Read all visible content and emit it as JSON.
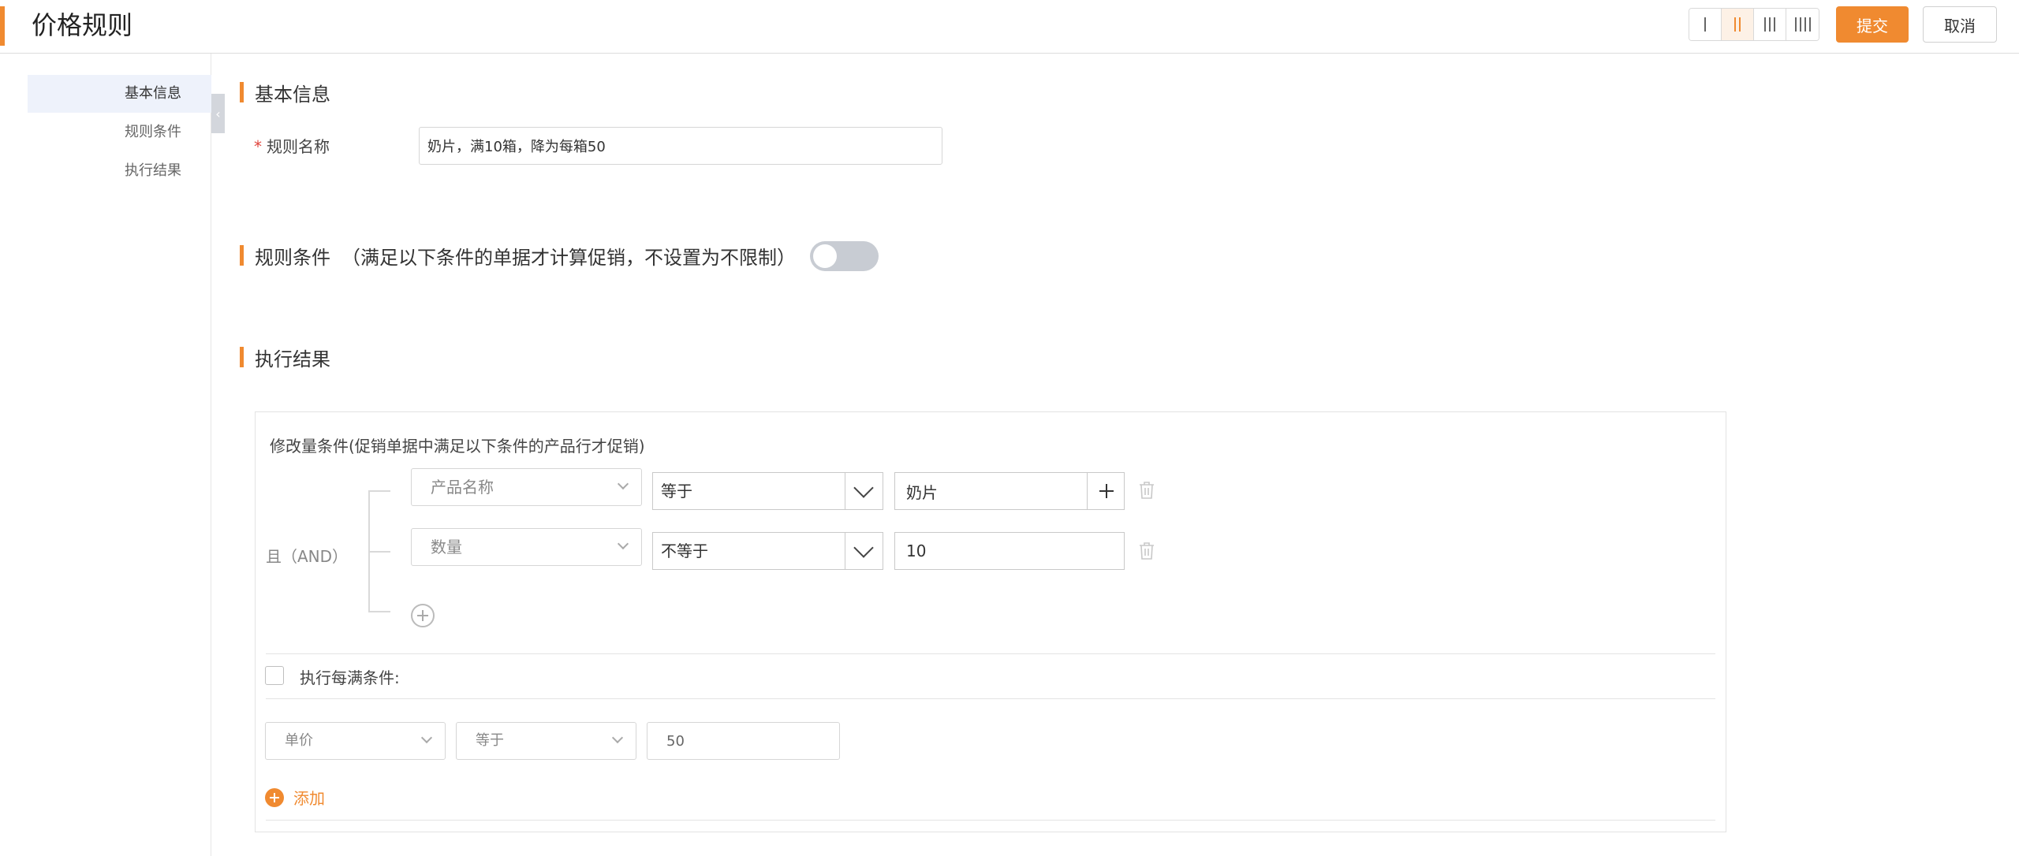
{
  "header": {
    "title": "价格规则",
    "submit_label": "提交",
    "cancel_label": "取消",
    "layout_options": [
      "1-column",
      "2-column",
      "3-column",
      "4-column"
    ],
    "layout_selected": "2-column"
  },
  "sidenav": {
    "items": [
      {
        "label": "基本信息",
        "active": true
      },
      {
        "label": "规则条件",
        "active": false
      },
      {
        "label": "执行结果",
        "active": false
      }
    ]
  },
  "basic": {
    "section_title": "基本信息",
    "rule_name_label": "规则名称",
    "rule_name_value": "奶片，满10箱，降为每箱50"
  },
  "conditions": {
    "section_title": "规则条件",
    "section_note": "（满足以下条件的单据才计算促销，不设置为不限制）",
    "enabled": false
  },
  "result": {
    "section_title": "执行结果",
    "box_title": "修改量条件(促销单据中满足以下条件的产品行才促销)",
    "logic_label": "且（AND）",
    "rows": [
      {
        "field": "产品名称",
        "operator": "等于",
        "value": "奶片"
      },
      {
        "field": "数量",
        "operator": "不等于",
        "value": "10"
      }
    ],
    "every_full_label": "执行每满条件:",
    "every_full_checked": false,
    "action": {
      "field": "单价",
      "operator": "等于",
      "value": "50"
    },
    "add_label": "添加"
  },
  "colors": {
    "accent": "#f08a30",
    "nav_active_bg": "#eef2fb",
    "toggle_off": "#c8ccd3"
  }
}
